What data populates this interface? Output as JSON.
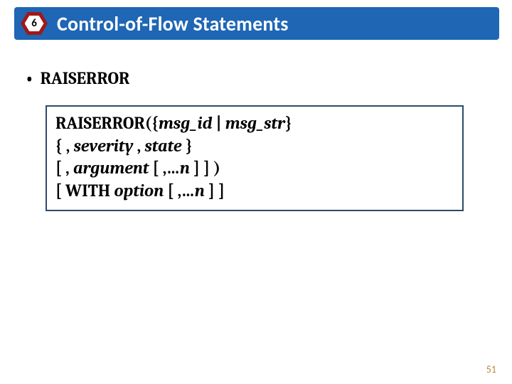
{
  "header": {
    "chapter_number": "6",
    "title": "Control-of-Flow Statements"
  },
  "bullet": {
    "label": "RAISERROR"
  },
  "syntax": {
    "keyword": "RAISERROR",
    "line1_open": "({",
    "arg_msg_id": "msg_id",
    "sep_pipe": " | ",
    "arg_msg_str": "msg_str",
    "line1_close": "}",
    "line2_open": "{ , ",
    "arg_severity": "severity",
    "line2_sep": " , ",
    "arg_state": "state",
    "line2_close": " }",
    "line3_open": "[ , ",
    "arg_argument": "argument",
    "line3_mid": " [ ,…",
    "arg_n1": "n",
    "line3_close": " ] ] )",
    "line4_open": "[ ",
    "kw_with": "WITH",
    "line4_sp": " ",
    "arg_option": "option",
    "line4_mid": " [ ,…",
    "arg_n2": "n",
    "line4_close": " ] ]"
  },
  "page_number": "51"
}
